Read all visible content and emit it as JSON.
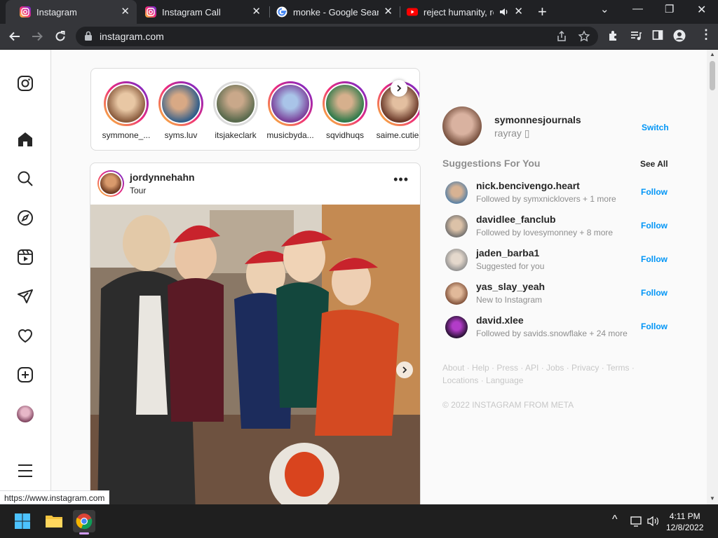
{
  "browser": {
    "tabs": [
      {
        "title": "Instagram",
        "favicon": "instagram-icon",
        "active": true
      },
      {
        "title": "Instagram Call",
        "favicon": "instagram-icon",
        "active": false
      },
      {
        "title": "monke - Google Search",
        "favicon": "google-icon",
        "active": false
      },
      {
        "title": "reject humanity, re",
        "favicon": "youtube-icon",
        "active": false,
        "audio": true
      }
    ],
    "url": "instagram.com",
    "status_url": "https://www.instagram.com"
  },
  "stories": [
    {
      "name": "symmone_...",
      "seen": false
    },
    {
      "name": "syms.luv",
      "seen": false
    },
    {
      "name": "itsjakeclark",
      "seen": true
    },
    {
      "name": "musicbyda...",
      "seen": false
    },
    {
      "name": "sqvidhuqs",
      "seen": false
    },
    {
      "name": "saime.cuties",
      "seen": false
    }
  ],
  "post": {
    "username": "jordynnehahn",
    "location": "Tour",
    "more": "•••"
  },
  "profile": {
    "username": "symonnesjournals",
    "name": "rayray ▯",
    "switch_label": "Switch"
  },
  "suggestions": {
    "title": "Suggestions For You",
    "see_all": "See All",
    "follow_label": "Follow",
    "items": [
      {
        "username": "nick.bencivengo.heart",
        "subtitle": "Followed by symxnicklovers + 1 more"
      },
      {
        "username": "davidlee_fanclub",
        "subtitle": "Followed by lovesymonney + 8 more"
      },
      {
        "username": "jaden_barba1",
        "subtitle": "Suggested for you"
      },
      {
        "username": "yas_slay_yeah",
        "subtitle": "New to Instagram"
      },
      {
        "username": "david.xlee",
        "subtitle": "Followed by savids.snowflake + 24 more"
      }
    ]
  },
  "footer": {
    "links": "About · Help · Press · API · Jobs · Privacy · Terms · Locations · Language",
    "copyright": "© 2022 INSTAGRAM FROM META"
  },
  "taskbar": {
    "time": "4:11 PM",
    "date": "12/8/2022"
  },
  "colors": {
    "accent": "#0095f6",
    "chrome_dark": "#202124",
    "chrome_toolbar": "#35363a"
  }
}
